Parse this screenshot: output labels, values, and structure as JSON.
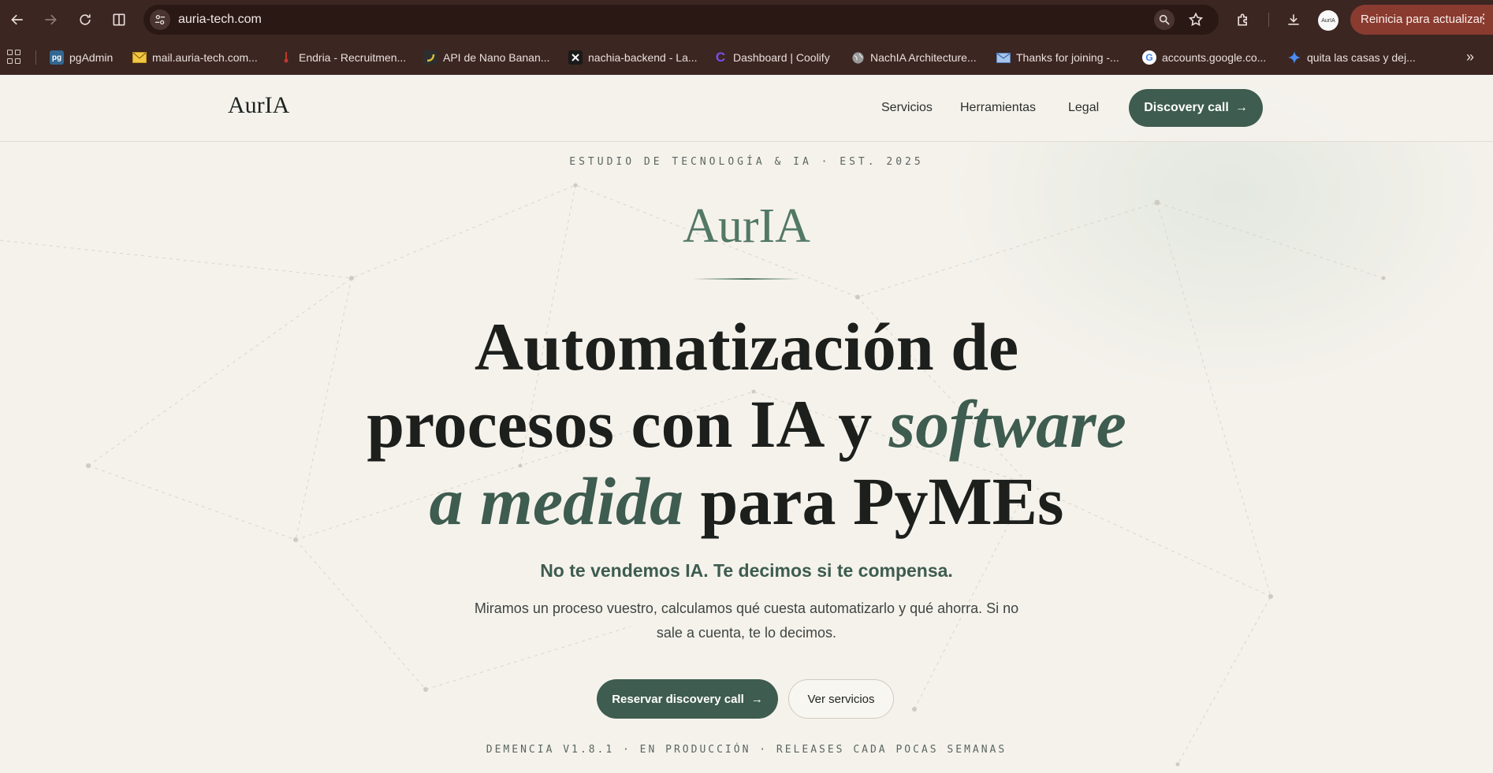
{
  "browser": {
    "url": "auria-tech.com",
    "update_label": "Reinicia para actualizar",
    "profile_label": "AurIA",
    "bookmarks": [
      {
        "label": "pgAdmin",
        "fav_text": "pg",
        "color": "#336791"
      },
      {
        "label": "mail.auria-tech.com...",
        "fav_text": "",
        "color": "#f2c744"
      },
      {
        "label": "Endria - Recruitmen...",
        "fav_text": "",
        "color": "#c0392b"
      },
      {
        "label": "API de Nano Banan...",
        "fav_text": "",
        "color": "#2e2e2e"
      },
      {
        "label": "nachia-backend - La...",
        "fav_text": "",
        "color": "#1a1a1a"
      },
      {
        "label": "Dashboard | Coolify",
        "fav_text": "C",
        "color": "#6b3fd6"
      },
      {
        "label": "NachIA Architecture...",
        "fav_text": "",
        "color": "#9a9a9a"
      },
      {
        "label": "Thanks for joining -...",
        "fav_text": "",
        "color": "#7fa7d9"
      },
      {
        "label": "accounts.google.co...",
        "fav_text": "G",
        "color": "#ffffff"
      },
      {
        "label": "quita las casas y dej...",
        "fav_text": "",
        "color": "#4b8cf0"
      }
    ]
  },
  "site": {
    "brand": "AurIA",
    "nav": [
      "Servicios",
      "Herramientas",
      "Legal"
    ],
    "cta": "Discovery call",
    "accent": "#3e5c50"
  },
  "hero": {
    "eyebrow": "ESTUDIO DE TECNOLOGÍA & IA · EST. 2025",
    "logo": "AurIA",
    "headline_l1": "Automatización de",
    "headline_l2_plain": "procesos con IA y ",
    "headline_l2_italic": "software",
    "headline_l3_italic": "a medida",
    "headline_l3_plain": " para PyMEs",
    "subhead": "No te vendemos IA. Te decimos si te compensa.",
    "lead": "Miramos un proceso vuestro, calculamos qué cuesta automatizarlo y qué ahorra. Si no sale a cuenta, te lo decimos.",
    "primary_cta": "Reservar discovery call",
    "secondary_cta": "Ver servicios",
    "footnote": "DEMENCIA V1.8.1 · EN PRODUCCIÓN · RELEASES CADA POCAS SEMANAS"
  }
}
